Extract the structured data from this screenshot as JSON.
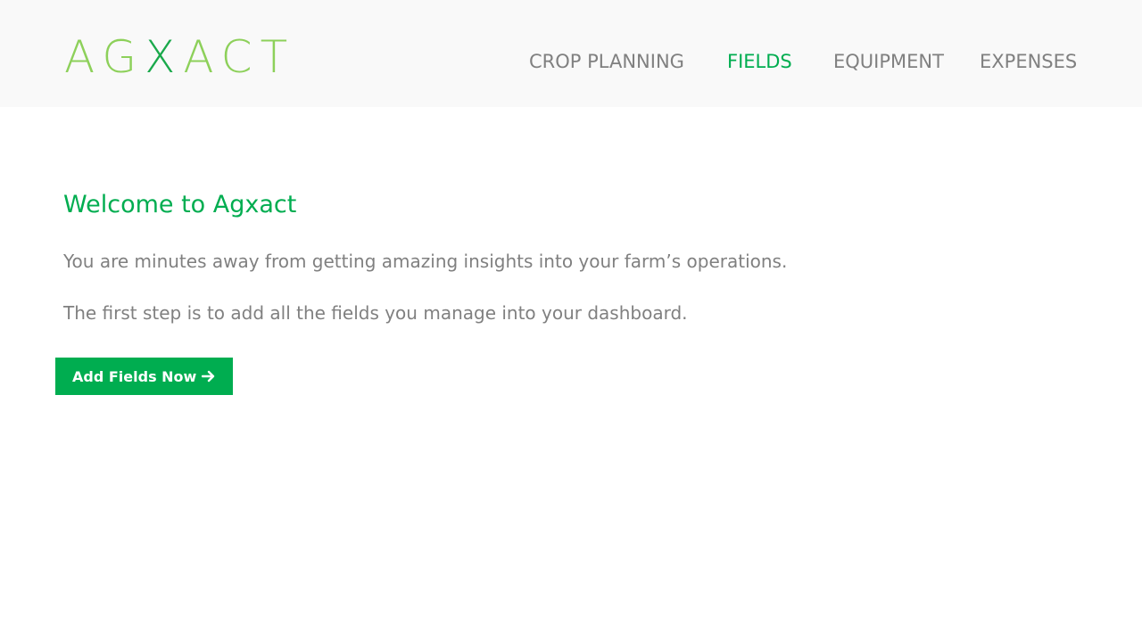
{
  "header": {
    "logo": {
      "part_a": "AG",
      "part_b": "X",
      "part_c": "ACT"
    },
    "nav": {
      "crop_planning": "CROP PLANNING",
      "fields": "FIELDS",
      "equipment": "EQUIPMENT",
      "expenses": "EXPENSES",
      "active": "FIELDS"
    }
  },
  "main": {
    "title": "Welcome to Agxact",
    "paragraph_1": "You are minutes away from getting amazing insights into your farm’s operations.",
    "paragraph_2": "The first step is to add all the fields you manage into your dashboard.",
    "cta_label": "Add Fields Now",
    "cta_icon": "arrow-right-icon"
  },
  "colors": {
    "brand_green": "#00ad50",
    "logo_light_green": "#8dd05a",
    "logo_dark_green": "#1aa94b",
    "nav_gray": "#808080",
    "header_bg": "#f9f9f9"
  }
}
